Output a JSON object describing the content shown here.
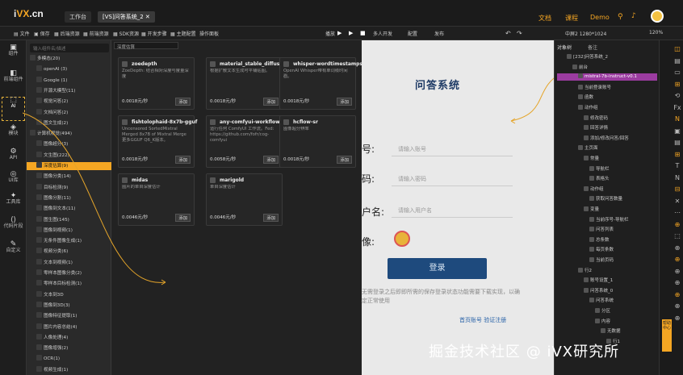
{
  "topbar": {
    "logo_prefix": "i",
    "logo_main": "VX",
    "logo_suffix": ".cn",
    "tabs": [
      "工作台",
      "[VS]问答系统_2"
    ],
    "nav": [
      "文档",
      "课程",
      "Demo"
    ]
  },
  "toolbar": {
    "left": [
      "文件",
      "保存",
      "后端资源",
      "前端资源",
      "SDK资源",
      "开发步骤",
      "主题配置",
      "操作面板"
    ],
    "center": [
      "播放",
      "多人开发",
      "配置",
      "发布"
    ],
    "resolution": "中屏2 1280*1024",
    "zoom": "120%"
  },
  "rail": [
    {
      "label": "组件",
      "icon": "box-icon"
    },
    {
      "label": "前端组件",
      "icon": "page-icon"
    },
    {
      "label": "AI",
      "icon": "ai-icon"
    },
    {
      "label": "模块",
      "icon": "module-icon"
    },
    {
      "label": "API",
      "icon": "api-icon"
    },
    {
      "label": "UI库",
      "icon": "ui-icon"
    },
    {
      "label": "工具库",
      "icon": "tools-icon"
    },
    {
      "label": "代码片段",
      "icon": "code-icon"
    },
    {
      "label": "自定义",
      "icon": "custom-icon"
    }
  ],
  "categories": {
    "search_placeholder": "输入组件名/描述",
    "items": [
      "多模态(20)",
      "openAI (3)",
      "Google (1)",
      "开源大模型(11)",
      "视觉问答(2)",
      "文档问答(2)",
      "图文生成(2)",
      "计算机视觉(494)",
      "图像超分(3)",
      "文生图(222)",
      "深度估算(9)",
      "图像分类(14)",
      "目标检测(9)",
      "图像分割(11)",
      "图像到文本(11)",
      "图生图(145)",
      "图像到视频(1)",
      "无条件图像生成(1)",
      "视频分类(6)",
      "文本到视频(1)",
      "零样本图像分类(2)",
      "零样本目标检测(1)",
      "文本到3D",
      "图像到3D(3)",
      "图像特征提取(1)",
      "图片内容总结(4)",
      "人像处理(4)",
      "图像增强(2)",
      "OCR(1)",
      "视频生成(1)"
    ],
    "selected": "深度估算(9)"
  },
  "models": {
    "search_value": "深度估算",
    "add_label": "添加",
    "cards": [
      {
        "title": "zoedepth",
        "desc": "ZoeDepth: 结合相对深度与度量深度",
        "price": "0.0018元/秒"
      },
      {
        "title": "material_stable_diffusion",
        "desc": "根据扩散文本生成可平铺贴图。",
        "price": "0.0018元/秒"
      },
      {
        "title": "whisper-wordtimestamps",
        "desc": "OpenAI Whisper带有单词级时间戳。",
        "price": "0.0018元/秒"
      },
      {
        "title": "fishtolophaid-8x7b-gguf",
        "desc": "Uncensored SortedMixtral Merged 8x7B of Mixtral Merge 更多GGUF Q6_K版本。",
        "price": "0.0018元/秒"
      },
      {
        "title": "any-comfyui-workflow",
        "desc": "运行任何 ComfyUI 工作流。Fed: https://github.com/fofr/cog-comfyui",
        "price": "0.0058元/秒"
      },
      {
        "title": "hcflow-sr",
        "desc": "图像超分辨率",
        "price": "0.0018元/秒"
      },
      {
        "title": "midas",
        "desc": "图片的单目深度估计",
        "price": "0.0046元/秒"
      },
      {
        "title": "marigold",
        "desc": "单目深度估计",
        "price": "0.0046元/秒"
      }
    ]
  },
  "canvas": {
    "title": "问答系统",
    "labels": [
      "号:",
      "码:",
      "户名:",
      "像:"
    ],
    "placeholders": [
      "请输入账号",
      "请输入密码",
      "请输入用户名"
    ],
    "login": "登录",
    "notice": "无需登录之后即即所需的保存登录状态功能需要下载实现，以确定正常使用",
    "links": "首页账号    验证注册"
  },
  "layers": {
    "tab": "备注",
    "rows": [
      "[232]问答系统_2",
      "前台",
      "mistral-7b-instruct-v0.1",
      "当前登录账号",
      "函数",
      "动作组",
      "修改密码",
      "回答详情",
      "添加/修改问答/回答",
      "主页面",
      "常量",
      "导航栏",
      "表格头",
      "动作组",
      "获取问答数量",
      "变量",
      "当前序号-导航栏",
      "问答列表",
      "总条数",
      "每页条数",
      "当前页码",
      "行2",
      "账号设置_1",
      "问答系统_0",
      "问答系统",
      "分区",
      "内容",
      "无数据",
      "行1"
    ]
  },
  "help": "帮助中心",
  "watermark": "掘金技术社区 @ iVX研究所",
  "colors": {
    "accent": "#f5a623",
    "canvas_bg": "#e9e9e9",
    "login_btn": "#1e4a7d"
  }
}
